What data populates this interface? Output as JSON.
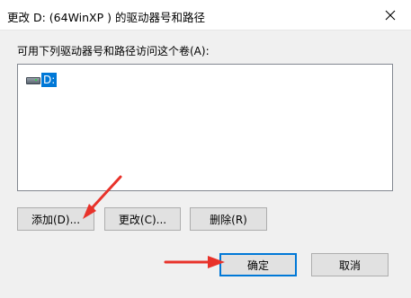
{
  "dialog": {
    "title": "更改 D: (64WinXP ) 的驱动器号和路径",
    "prompt": "可用下列驱动器号和路径访问这个卷(A):",
    "close_icon": "close-icon"
  },
  "list": {
    "items": [
      {
        "label": "D:",
        "icon": "drive-icon",
        "selected": true
      }
    ]
  },
  "buttons": {
    "add": "添加(D)...",
    "change": "更改(C)...",
    "remove": "删除(R)",
    "ok": "确定",
    "cancel": "取消"
  },
  "annotations": {
    "arrow_color": "#e8322a"
  },
  "colors": {
    "selection": "#0078d7",
    "window_bg": "#f0f0f0",
    "titlebar_bg": "#ffffff"
  }
}
